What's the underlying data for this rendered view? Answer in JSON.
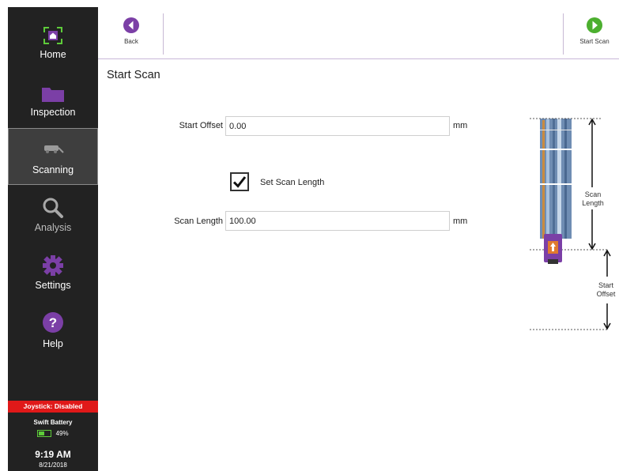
{
  "sidebar": {
    "items": [
      {
        "label": "Home",
        "icon": "home-icon"
      },
      {
        "label": "Inspection",
        "icon": "folder-icon"
      },
      {
        "label": "Scanning",
        "icon": "scanner-icon"
      },
      {
        "label": "Analysis",
        "icon": "magnifier-icon"
      },
      {
        "label": "Settings",
        "icon": "gear-icon"
      },
      {
        "label": "Help",
        "icon": "help-icon"
      }
    ],
    "active": "Scanning",
    "joystick_label": "Joystick:",
    "joystick_status": "Disabled",
    "battery_title": "Swift Battery",
    "battery_percent": "49%",
    "battery_level": 0.49,
    "time": "9:19 AM",
    "date": "8/21/2018"
  },
  "toolbar": {
    "back_label": "Back",
    "start_scan_label": "Start Scan"
  },
  "page": {
    "title": "Start Scan"
  },
  "form": {
    "start_offset_label": "Start Offset",
    "start_offset_value": "0.00",
    "start_offset_unit": "mm",
    "set_scan_length_label": "Set Scan Length",
    "set_scan_length_checked": true,
    "scan_length_label": "Scan Length",
    "scan_length_value": "100.00",
    "scan_length_unit": "mm"
  },
  "diagram": {
    "scan_length_label": "Scan Length",
    "start_offset_label": "Start Offset"
  },
  "colors": {
    "sidebar_bg": "#222222",
    "accent_purple": "#7b3fa6",
    "start_green": "#4caf2f",
    "joystick_red": "#e01919",
    "home_green": "#5ecb3a"
  }
}
